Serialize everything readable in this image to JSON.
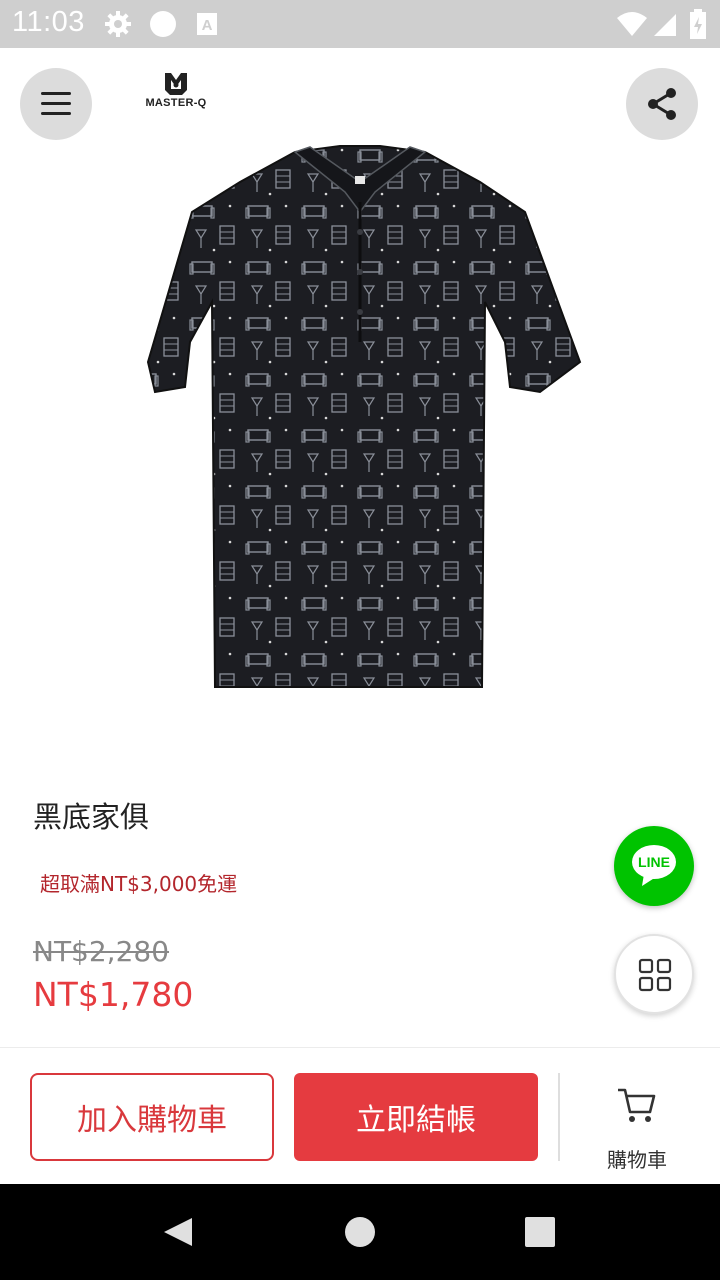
{
  "status_bar": {
    "time": "11:03",
    "icons": [
      "gear-icon",
      "circle-icon",
      "a-icon",
      "wifi-icon",
      "signal-icon",
      "battery-icon"
    ]
  },
  "header": {
    "logo_text": "MASTER-Q",
    "menu_icon": "menu-icon",
    "share_icon": "share-icon"
  },
  "product": {
    "name": "黑底家俱",
    "free_shipping_text": "超取滿NT$3,000免運",
    "original_price": "NT$2,280",
    "sale_price": "NT$1,780"
  },
  "floating": {
    "line_label": "LINE",
    "grid_icon": "grid-icon"
  },
  "actions": {
    "add_to_cart": "加入購物車",
    "checkout": "立即結帳",
    "cart_label": "購物車"
  },
  "colors": {
    "accent_red": "#e53b40",
    "line_green": "#00c300",
    "shipping_text": "#b3262c"
  }
}
